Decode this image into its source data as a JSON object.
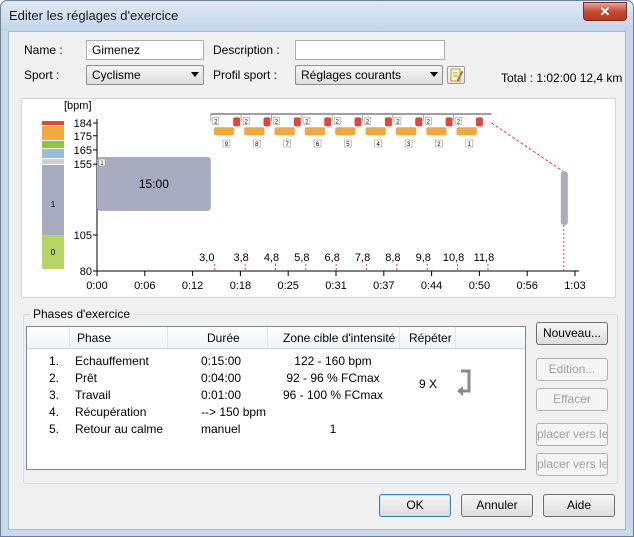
{
  "window": {
    "title": "Editer les réglages d'exercice",
    "close_glyph": "✕"
  },
  "form": {
    "name_label": "Name :",
    "name_value": "Gimenez",
    "description_label": "Description :",
    "description_value": "",
    "sport_label": "Sport :",
    "sport_value": "Cyclisme",
    "profile_label": "Profil sport :",
    "profile_value": "Réglages courants",
    "total_label": "Total : 1:02:00   12,4 km"
  },
  "chart_data": {
    "type": "bar",
    "ylabel": "[bpm]",
    "y_ticks": [
      "184",
      "175",
      "165",
      "155",
      "105",
      "80"
    ],
    "x_ticks": [
      "0:00",
      "0:06",
      "0:12",
      "0:18",
      "0:25",
      "0:31",
      "0:37",
      "0:44",
      "0:50",
      "0:56",
      "1:03"
    ],
    "distance_labels": [
      "3,0",
      "3,8",
      "4,8",
      "5,8",
      "6,8",
      "7,8",
      "8,8",
      "9,8",
      "10,8",
      "11,8"
    ],
    "zones": [
      {
        "color": "#e0473c",
        "label": ""
      },
      {
        "color": "#f2a93b",
        "label": ""
      },
      {
        "color": "#8cc63f",
        "label": ""
      },
      {
        "color": "#9bbbd9",
        "label": ""
      },
      {
        "color": "#a9acc0",
        "label": "1"
      },
      {
        "color": "#b8d366",
        "label": "0"
      }
    ],
    "warmup": {
      "label": "15:00",
      "start_min": 0,
      "end_min": 15,
      "low": 122,
      "high": 160,
      "phase_no": "1"
    },
    "repeats": [
      {
        "work_no": "2",
        "rest_no": "9"
      },
      {
        "work_no": "2",
        "rest_no": "8"
      },
      {
        "work_no": "2",
        "rest_no": "7"
      },
      {
        "work_no": "2",
        "rest_no": "6"
      },
      {
        "work_no": "2",
        "rest_no": "5"
      },
      {
        "work_no": "2",
        "rest_no": "4"
      },
      {
        "work_no": "2",
        "rest_no": "3"
      },
      {
        "work_no": "2",
        "rest_no": "2"
      },
      {
        "work_no": "2",
        "rest_no": "1"
      }
    ]
  },
  "phases": {
    "group_title": "Phases d'exercice",
    "headers": {
      "phase": "Phase",
      "duration": "Durée",
      "zone": "Zone cible d'intensité",
      "repeat": "Répéter"
    },
    "rows": [
      {
        "no": "1.",
        "phase": "Echauffement",
        "duration": "0:15:00",
        "zone": "122 - 160 bpm"
      },
      {
        "no": "2.",
        "phase": "Prêt",
        "duration": "0:04:00",
        "zone": "92 - 96 % FCmax"
      },
      {
        "no": "3.",
        "phase": "Travail",
        "duration": "0:01:00",
        "zone": "96 - 100 % FCmax"
      },
      {
        "no": "4.",
        "phase": "Récupération",
        "duration": "--> 150 bpm",
        "zone": ""
      },
      {
        "no": "5.",
        "phase": "Retour au calme",
        "duration": "manuel",
        "zone": "1"
      }
    ],
    "repeat_count": "9 X"
  },
  "side_buttons": {
    "new": "Nouveau...",
    "edit": "Edition...",
    "delete": "Effacer",
    "move_up": "placer vers le h",
    "move_down": "placer vers le b"
  },
  "footer": {
    "ok": "OK",
    "cancel": "Annuler",
    "help": "Aide"
  }
}
